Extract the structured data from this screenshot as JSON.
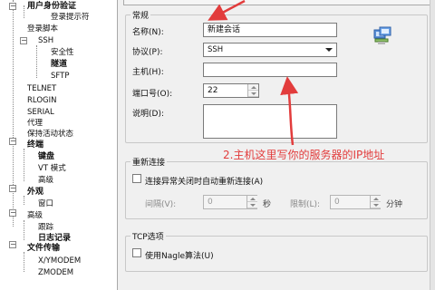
{
  "tree": {
    "items": [
      {
        "label": "用户身份验证",
        "bold": true
      },
      {
        "label": "登录提示符",
        "bold": false
      },
      {
        "label": "登录脚本",
        "bold": false
      },
      {
        "label": "SSH",
        "bold": false
      },
      {
        "label": "安全性",
        "bold": false
      },
      {
        "label": "隧道",
        "bold": true
      },
      {
        "label": "SFTP",
        "bold": false
      },
      {
        "label": "TELNET",
        "bold": false
      },
      {
        "label": "RLOGIN",
        "bold": false
      },
      {
        "label": "SERIAL",
        "bold": false
      },
      {
        "label": "代理",
        "bold": false
      },
      {
        "label": "保持活动状态",
        "bold": false
      },
      {
        "label": "终端",
        "bold": true
      },
      {
        "label": "键盘",
        "bold": true
      },
      {
        "label": "VT 模式",
        "bold": false
      },
      {
        "label": "高级",
        "bold": false
      },
      {
        "label": "外观",
        "bold": true
      },
      {
        "label": "窗口",
        "bold": false
      },
      {
        "label": "高级",
        "bold": false
      },
      {
        "label": "跟踪",
        "bold": false
      },
      {
        "label": "日志记录",
        "bold": true
      },
      {
        "label": "文件传输",
        "bold": true
      },
      {
        "label": "X/YMODEM",
        "bold": false
      },
      {
        "label": "ZMODEM",
        "bold": false
      }
    ]
  },
  "general": {
    "title": "常规",
    "name_label": "名称(N):",
    "name_value": "新建会话",
    "protocol_label": "协议(P):",
    "protocol_value": "SSH",
    "host_label": "主机(H):",
    "host_value": "",
    "port_label": "端口号(O):",
    "port_value": "22",
    "desc_label": "说明(D):",
    "desc_value": ""
  },
  "reconnect": {
    "title": "重新连接",
    "auto_label": "连接异常关闭时自动重新连接(A)",
    "interval_label": "间隔(V):",
    "interval_value": "0",
    "interval_unit": "秒",
    "limit_label": "限制(L):",
    "limit_value": "0",
    "limit_unit": "分钟"
  },
  "tcp": {
    "title": "TCP选项",
    "nagle_label": "使用Nagle算法(U)"
  },
  "annotation": {
    "text": "2.主机这里写你的服务器的IP地址",
    "color": "#e23c3c"
  },
  "icons": {
    "network": "network-computer-icon"
  }
}
